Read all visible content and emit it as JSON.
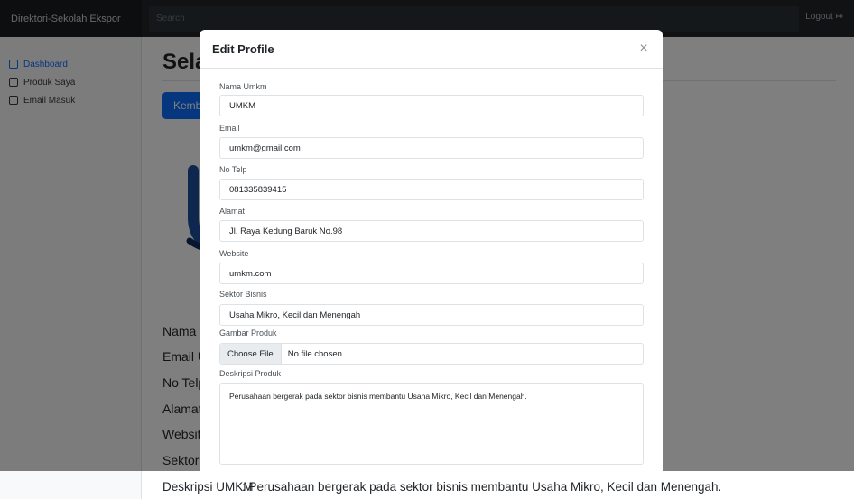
{
  "app": {
    "brand": "Direktori-Sekolah Ekspor",
    "search_placeholder": "Search",
    "logout": "Logout ↦"
  },
  "sidebar": {
    "items": [
      {
        "label": "Dashboard",
        "icon": "dashboard-icon"
      },
      {
        "label": "Produk Saya",
        "icon": "document-icon"
      },
      {
        "label": "Email Masuk",
        "icon": "mail-icon"
      }
    ]
  },
  "main": {
    "title": "Selamat Datang",
    "back_button": "Kembali",
    "info_rows": [
      "Nama UMKM",
      "Email UMKM",
      "No Telp",
      "Alamat",
      "Website",
      "Sektor Bisnis"
    ],
    "description_label": "Deskripsi UMKM",
    "description_value": ": Perusahaan bergerak pada sektor bisnis membantu Usaha Mikro, Kecil dan Menengah."
  },
  "modal": {
    "title": "Edit Profile",
    "close_glyph": "×",
    "fields": {
      "nama": {
        "label": "Nama Umkm",
        "value": "UMKM"
      },
      "email": {
        "label": "Email",
        "value": "umkm@gmail.com"
      },
      "telp": {
        "label": "No Telp",
        "value": "081335839415"
      },
      "alamat": {
        "label": "Alamat",
        "value": "Jl. Raya Kedung Baruk No.98"
      },
      "website": {
        "label": "Website",
        "value": "umkm.com"
      },
      "sektor": {
        "label": "Sektor Bisnis",
        "value": "Usaha Mikro, Kecil dan Menengah"
      },
      "gambar": {
        "label": "Gambar Produk",
        "button": "Choose File",
        "status": "No file chosen"
      },
      "deskripsi": {
        "label": "Deskripsi Produk",
        "value": "Perusahaan bergerak pada sektor bisnis membantu Usaha Mikro, Kecil dan Menengah."
      }
    }
  },
  "colors": {
    "primary": "#0d6efd",
    "navbar": "#212529",
    "backdrop": "rgba(0,0,0,0.5)",
    "logo_blue": "#1b4f9c",
    "logo_navy": "#0f2a5c"
  }
}
